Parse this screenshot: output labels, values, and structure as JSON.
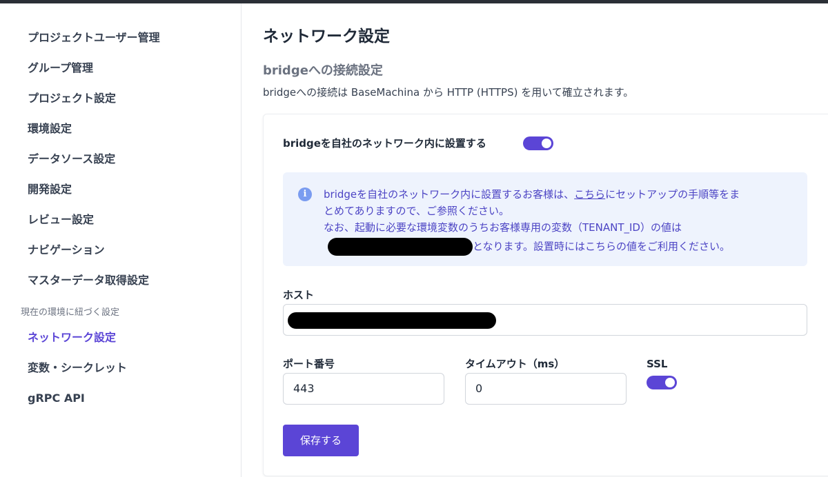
{
  "sidebar": {
    "items": [
      {
        "label": "プロジェクトユーザー管理"
      },
      {
        "label": "グループ管理"
      },
      {
        "label": "プロジェクト設定"
      },
      {
        "label": "環境設定"
      },
      {
        "label": "データソース設定"
      },
      {
        "label": "開発設定"
      },
      {
        "label": "レビュー設定"
      },
      {
        "label": "ナビゲーション"
      },
      {
        "label": "マスターデータ取得設定"
      }
    ],
    "section_label": "現在の環境に紐づく設定",
    "env_items": [
      {
        "label": "ネットワーク設定",
        "active": true
      },
      {
        "label": "変数・シークレット"
      },
      {
        "label": "gRPC API"
      }
    ]
  },
  "main": {
    "title": "ネットワーク設定",
    "section_title": "bridgeへの接続設定",
    "section_desc": "bridgeへの接続は BaseMachina から HTTP (HTTPS) を用いて確立されます。",
    "self_host_label": "bridgeを自社のネットワーク内に設置する",
    "self_host_enabled": true,
    "info": {
      "line1_pre": "bridgeを自社のネットワーク内に設置するお客様は、",
      "link_text": "こちら",
      "line1_post": "にセットアップの手順等をま",
      "line2": "とめてありますので、ご参照ください。",
      "line3": "なお、起動に必要な環境変数のうちお客様専用の変数（TENANT_ID）の値は",
      "line4_post": "となります。設置時にはこちらの値をご利用ください。"
    },
    "host_label": "ホスト",
    "port_label": "ポート番号",
    "port_value": "443",
    "timeout_label": "タイムアウト（ms）",
    "timeout_value": "0",
    "ssl_label": "SSL",
    "ssl_enabled": true,
    "save_label": "保存する"
  },
  "colors": {
    "accent": "#5b45d6",
    "info_bg": "#eef3fd",
    "info_text": "#4c44c4"
  }
}
